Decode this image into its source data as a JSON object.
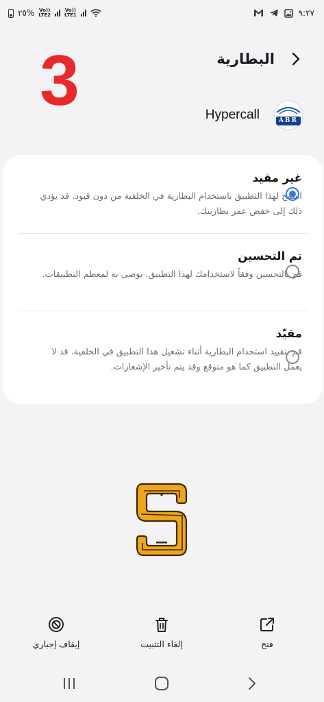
{
  "status_bar": {
    "battery_percent": "٢٥%",
    "sim2_label": "Vo))\nLTE2",
    "sim1_label": "Vo))\nLTE1",
    "time": "٩:٢٧",
    "icons": [
      "battery-icon",
      "signal-icon",
      "wifi-icon",
      "gmail-icon",
      "telegram-icon",
      "gallery-icon"
    ]
  },
  "header": {
    "title": "البطارية",
    "back_icon": "chevron-back-icon",
    "overlay_number": "3"
  },
  "app": {
    "name": "Hypercall",
    "icon_letters": "ABR"
  },
  "options": [
    {
      "title": "غير مقيد",
      "description": "اسمح لهذا التطبيق باستخدام البطارية في الخلفية من دون قيود. قد يؤدي ذلك إلى خفض عمر بطاريتك.",
      "selected": true
    },
    {
      "title": "تم التحسين",
      "description": "قم بالتحسين وفقاً لاستخدامك لهذا التطبيق. يوصى به لمعظم التطبيقات.",
      "selected": false
    },
    {
      "title": "مقيّد",
      "description": "قم بتقييد استخدام البطارية أثناء تشغيل هذا التطبيق في الخلفية. قد لا يعمل التطبيق كما هو متوقع وقد يتم تأخير الإشعارات.",
      "selected": false
    }
  ],
  "actions": {
    "force_stop": "إيقاف إجباري",
    "uninstall": "إلغاء التثبيت",
    "open": "فتح"
  },
  "colors": {
    "accent": "#3a78e6",
    "overlay_number": "#e8292b",
    "logo_orange": "#f0a51c"
  }
}
